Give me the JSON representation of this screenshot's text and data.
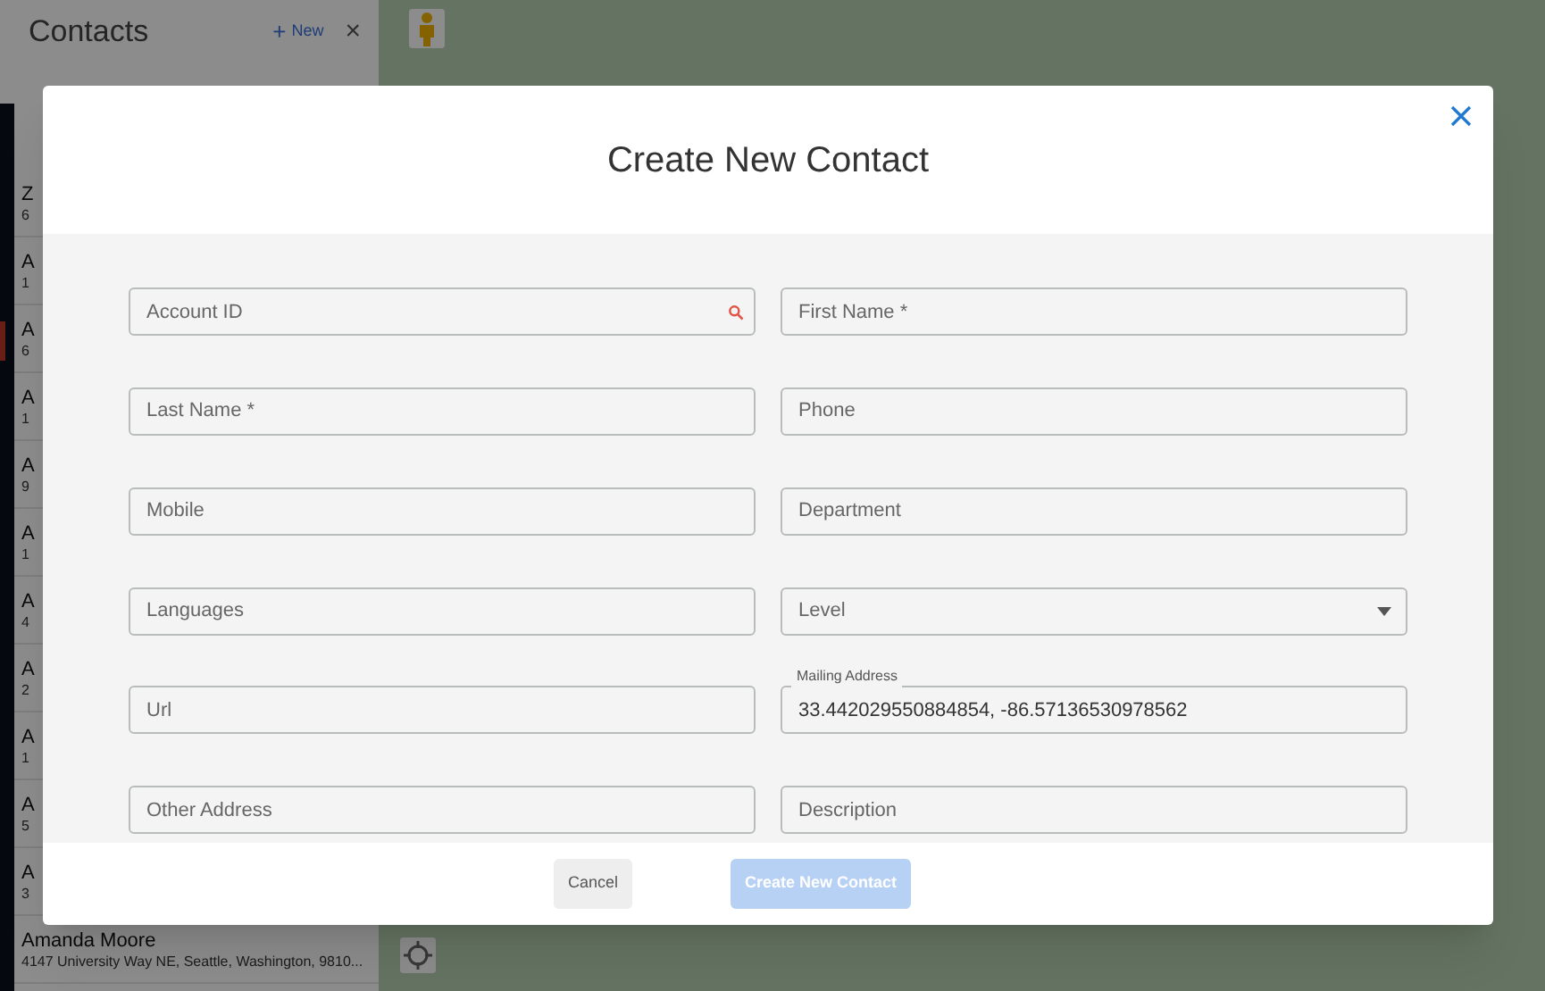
{
  "sidebar": {
    "title": "Contacts",
    "new_button": {
      "icon": "+",
      "label": "New"
    },
    "close": "×",
    "items": [
      {
        "name": "Z",
        "detail": "6"
      },
      {
        "name": "A",
        "detail": "1"
      },
      {
        "name": "A",
        "detail": "6"
      },
      {
        "name": "A",
        "detail": "1"
      },
      {
        "name": "A",
        "detail": "9"
      },
      {
        "name": "A",
        "detail": "1"
      },
      {
        "name": "A",
        "detail": "4"
      },
      {
        "name": "A",
        "detail": "2"
      },
      {
        "name": "A",
        "detail": "1"
      },
      {
        "name": "A",
        "detail": "5"
      },
      {
        "name": "A",
        "detail": "3"
      },
      {
        "name": "Amanda Moore",
        "detail": "4147 University Way NE, Seattle, Washington, 9810..."
      }
    ]
  },
  "dialog": {
    "title": "Create New Contact",
    "fields": [
      {
        "kind": "search",
        "placeholder": "Account ID"
      },
      {
        "kind": "text",
        "placeholder": "Last Name *"
      },
      {
        "kind": "text",
        "placeholder": "Mobile"
      },
      {
        "kind": "text",
        "placeholder": "Languages"
      },
      {
        "kind": "text",
        "placeholder": "Url"
      },
      {
        "kind": "text",
        "placeholder": "Other Address"
      },
      {
        "kind": "text",
        "placeholder": "First Name *"
      },
      {
        "kind": "text",
        "placeholder": "Phone"
      },
      {
        "kind": "text",
        "placeholder": "Department"
      },
      {
        "kind": "select",
        "placeholder": "Level"
      },
      {
        "kind": "text",
        "label": "Mailing Address",
        "value": "33.442029550884854, -86.57136530978562"
      },
      {
        "kind": "text",
        "placeholder": "Description"
      }
    ],
    "buttons": [
      {
        "label": "Cancel",
        "disabled": false
      },
      {
        "label": "Create New Contact",
        "disabled": true
      }
    ]
  }
}
